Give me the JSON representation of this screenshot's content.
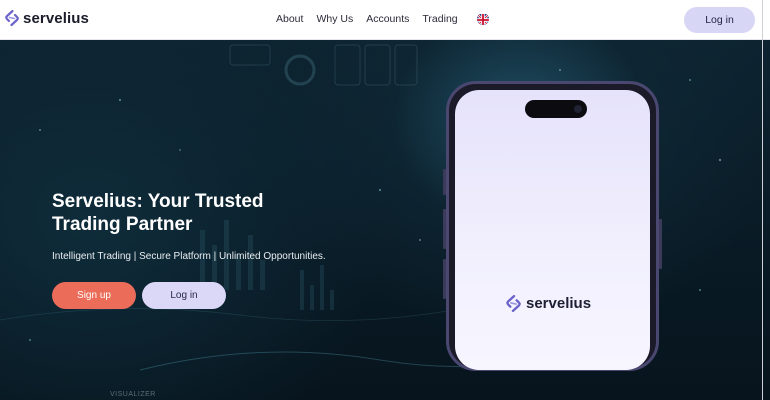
{
  "header": {
    "logo_text": "servelius",
    "logo_icon": "servelius-logo-mark",
    "nav": [
      {
        "label": "About"
      },
      {
        "label": "Why Us"
      },
      {
        "label": "Accounts"
      },
      {
        "label": "Trading"
      }
    ],
    "language_icon": "uk-flag-icon",
    "login_label": "Log in"
  },
  "hero": {
    "title": "Servelius: Your Trusted Trading Partner",
    "subtitle": "Intelligent Trading | Secure Platform | Unlimited Opportunities.",
    "signup_label": "Sign up",
    "login_label": "Log in",
    "watermark": "VISUALIZER"
  },
  "phone": {
    "logo_text": "servelius"
  },
  "colors": {
    "accent_coral": "#ea6c59",
    "accent_lavender": "#d7d6f5",
    "hero_dark": "#0b1a24"
  }
}
